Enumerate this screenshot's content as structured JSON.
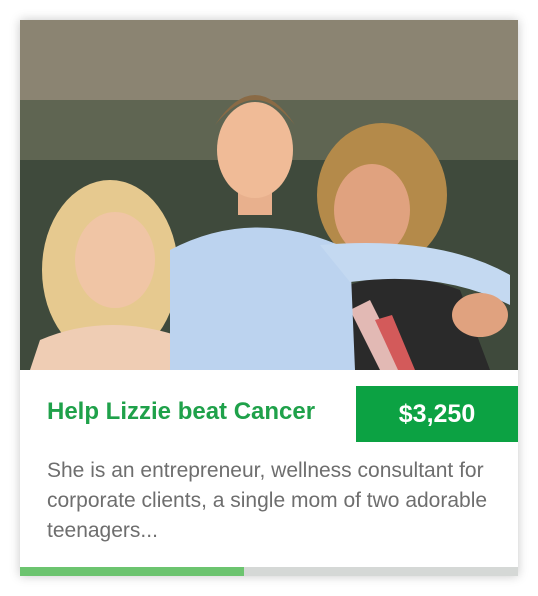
{
  "campaign": {
    "photo_alt": "Three people posing together outdoors",
    "title": "Help Lizzie beat Cancer",
    "amount": "$3,250",
    "description": "She is an entrepreneur, wellness consultant for corporate clients, a single mom of two adorable teenagers...",
    "progress_fraction": 0.45
  },
  "colors": {
    "accent": "#0ca243",
    "title": "#1fa14a",
    "progress_fill": "#6cc46f",
    "progress_track": "#d5d8d6",
    "text_muted": "#6e6e6e"
  }
}
